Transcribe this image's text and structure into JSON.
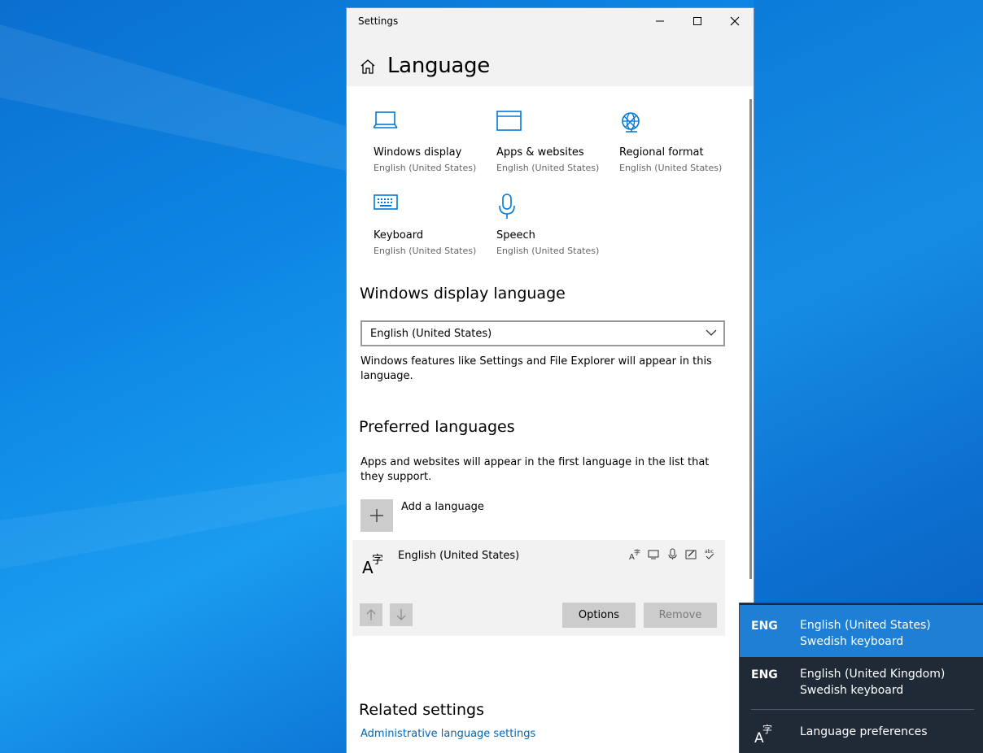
{
  "window": {
    "title": "Settings",
    "page_title": "Language"
  },
  "tiles": [
    {
      "label": "Windows display",
      "sub": "English (United States)",
      "icon": "laptop-icon"
    },
    {
      "label": "Apps & websites",
      "sub": "English (United States)",
      "icon": "browser-window-icon"
    },
    {
      "label": "Regional format",
      "sub": "English (United States)",
      "icon": "globe-icon"
    },
    {
      "label": "Keyboard",
      "sub": "English (United States)",
      "icon": "keyboard-icon"
    },
    {
      "label": "Speech",
      "sub": "English (United States)",
      "icon": "microphone-icon"
    }
  ],
  "display_language": {
    "heading": "Windows display language",
    "selected": "English (United States)",
    "description": "Windows features like Settings and File Explorer will appear in this language."
  },
  "preferred": {
    "heading": "Preferred languages",
    "description": "Apps and websites will appear in the first language in the list that they support.",
    "add_label": "Add a language",
    "languages": [
      {
        "name": "English (United States)"
      }
    ],
    "options_label": "Options",
    "remove_label": "Remove"
  },
  "related": {
    "heading": "Related settings",
    "link": "Administrative language settings"
  },
  "flyout": {
    "items": [
      {
        "code": "ENG",
        "language": "English (United States)",
        "keyboard": "Swedish keyboard",
        "active": true
      },
      {
        "code": "ENG",
        "language": "English (United Kingdom)",
        "keyboard": "Swedish keyboard",
        "active": false
      }
    ],
    "preferences_label": "Language preferences"
  },
  "colors": {
    "accent": "#0078d7",
    "link": "#0067b8",
    "flyout_bg": "#1f2a36",
    "flyout_active": "#1f7fd4"
  }
}
